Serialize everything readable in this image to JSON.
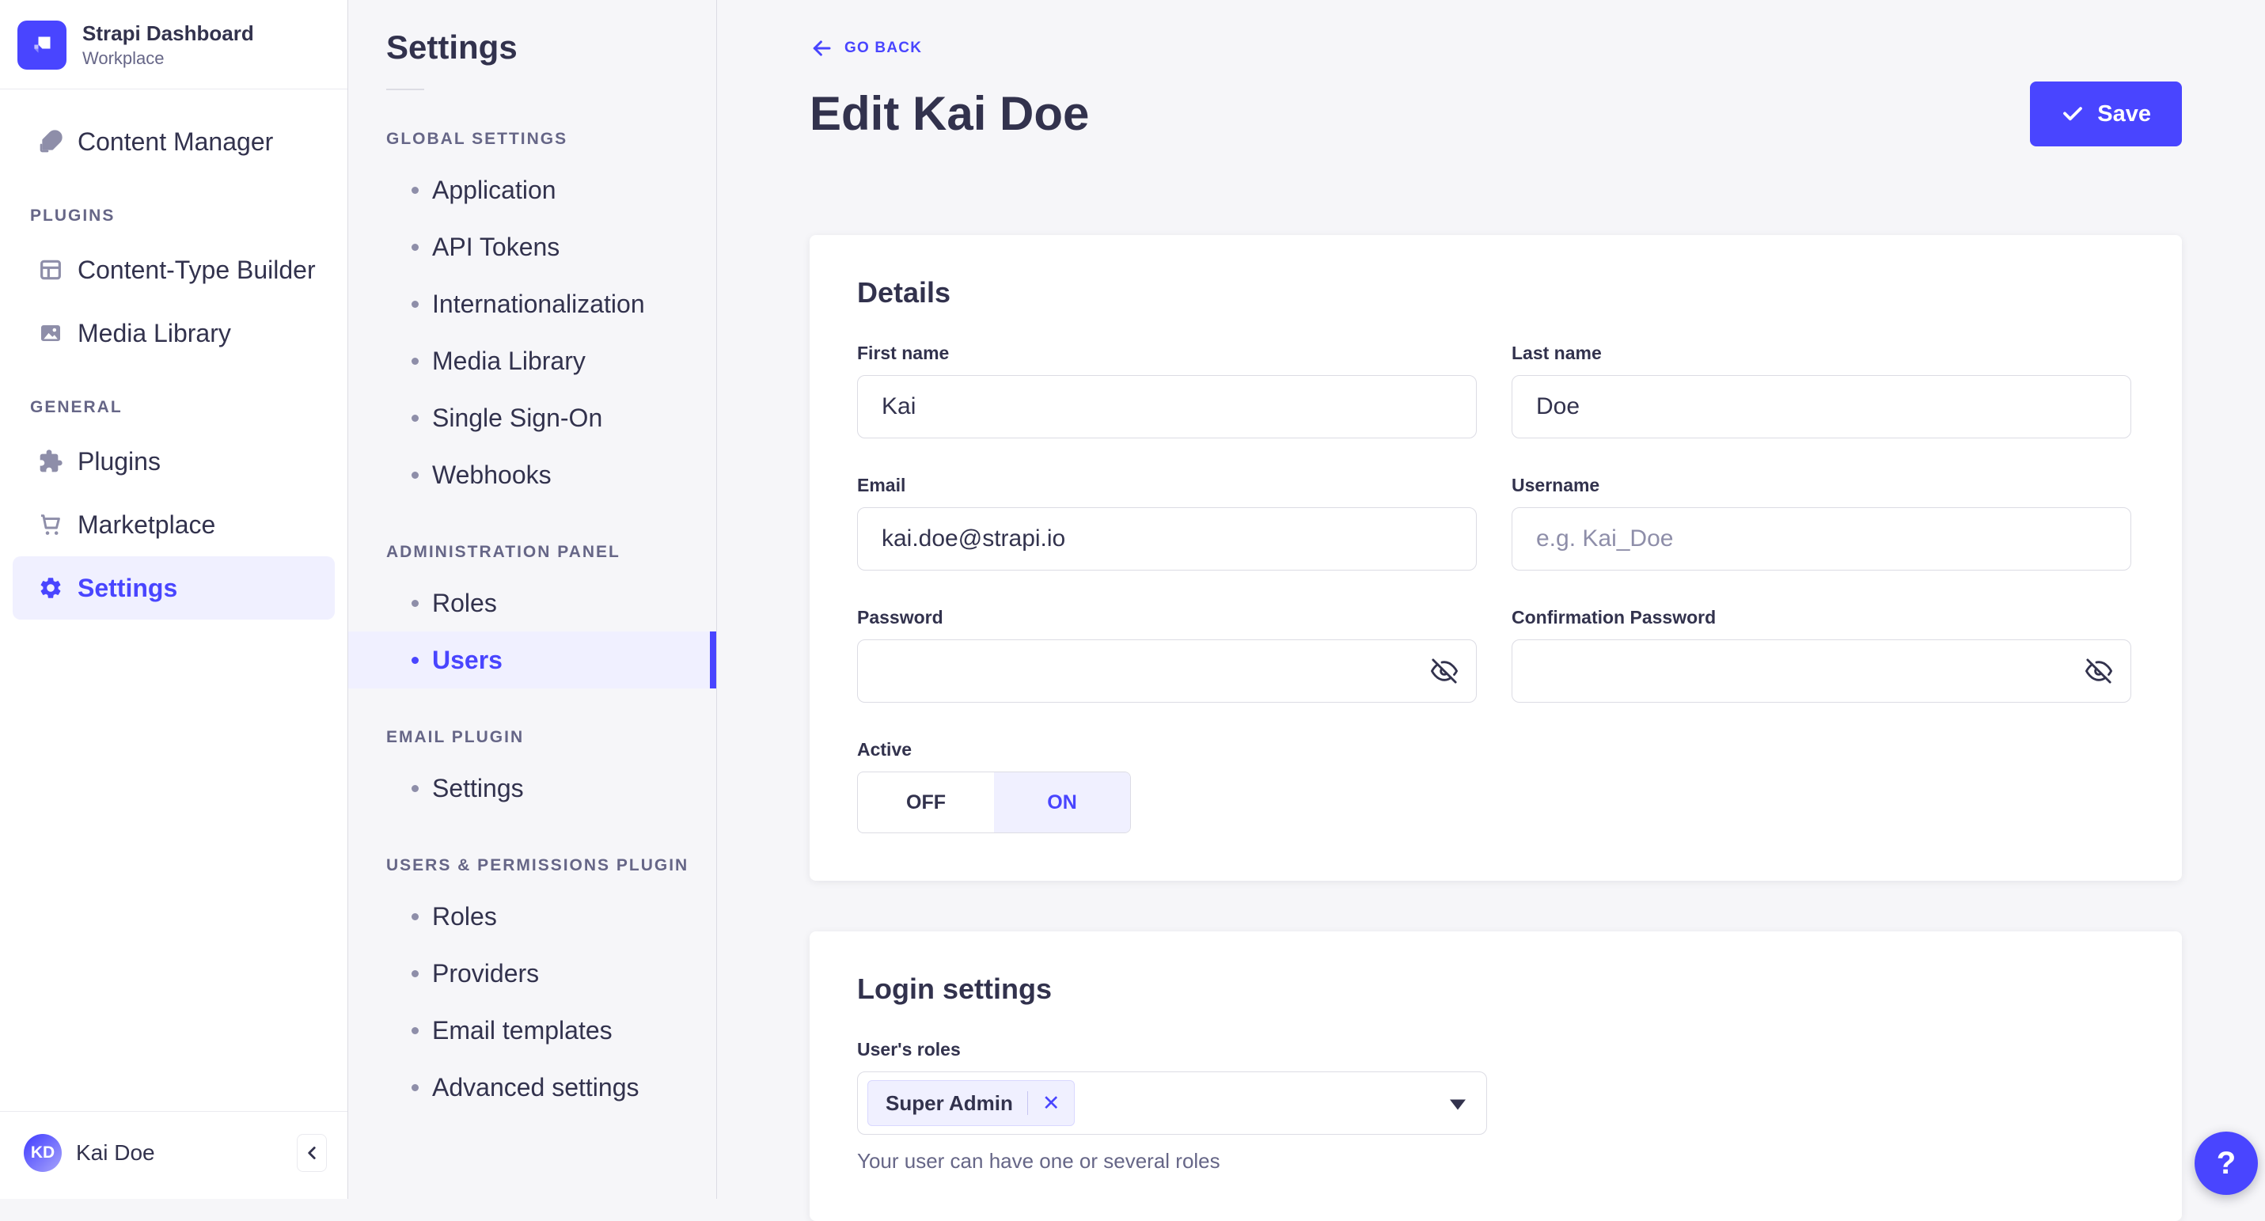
{
  "colors": {
    "primary": "#4945FF",
    "primary_light_bg": "#F0F0FF",
    "text_dark": "#32324D",
    "text_muted": "#666687",
    "border": "#DCDCE4",
    "page_bg": "#F6F6F9"
  },
  "brand": {
    "title": "Strapi Dashboard",
    "subtitle": "Workplace"
  },
  "sidebar": {
    "items": [
      {
        "label": "Content Manager"
      }
    ],
    "sections": [
      {
        "label": "PLUGINS",
        "items": [
          {
            "label": "Content-Type Builder"
          },
          {
            "label": "Media Library"
          }
        ]
      },
      {
        "label": "GENERAL",
        "items": [
          {
            "label": "Plugins"
          },
          {
            "label": "Marketplace"
          },
          {
            "label": "Settings",
            "active": true
          }
        ]
      }
    ],
    "user": {
      "initials": "KD",
      "name": "Kai Doe"
    }
  },
  "subnav": {
    "title": "Settings",
    "sections": [
      {
        "label": "GLOBAL SETTINGS",
        "items": [
          {
            "label": "Application"
          },
          {
            "label": "API Tokens"
          },
          {
            "label": "Internationalization"
          },
          {
            "label": "Media Library"
          },
          {
            "label": "Single Sign-On"
          },
          {
            "label": "Webhooks"
          }
        ]
      },
      {
        "label": "ADMINISTRATION PANEL",
        "items": [
          {
            "label": "Roles"
          },
          {
            "label": "Users",
            "active": true
          }
        ]
      },
      {
        "label": "EMAIL PLUGIN",
        "items": [
          {
            "label": "Settings"
          }
        ]
      },
      {
        "label": "USERS & PERMISSIONS PLUGIN",
        "items": [
          {
            "label": "Roles"
          },
          {
            "label": "Providers"
          },
          {
            "label": "Email templates"
          },
          {
            "label": "Advanced settings"
          }
        ]
      }
    ]
  },
  "header": {
    "back_label": "GO BACK",
    "title": "Edit Kai Doe",
    "save_label": "Save"
  },
  "details": {
    "heading": "Details",
    "fields": {
      "first_name": {
        "label": "First name",
        "value": "Kai"
      },
      "last_name": {
        "label": "Last name",
        "value": "Doe"
      },
      "email": {
        "label": "Email",
        "value": "kai.doe@strapi.io"
      },
      "username": {
        "label": "Username",
        "placeholder": "e.g. Kai_Doe"
      },
      "password": {
        "label": "Password"
      },
      "confirmation_password": {
        "label": "Confirmation Password"
      },
      "active": {
        "label": "Active",
        "off_label": "OFF",
        "on_label": "ON",
        "value": "ON"
      }
    }
  },
  "login": {
    "heading": "Login settings",
    "roles_label": "User's roles",
    "selected_role": "Super Admin",
    "remove_role_label": "✕",
    "helper": "Your user can have one or several roles"
  },
  "help": {
    "label": "?"
  }
}
